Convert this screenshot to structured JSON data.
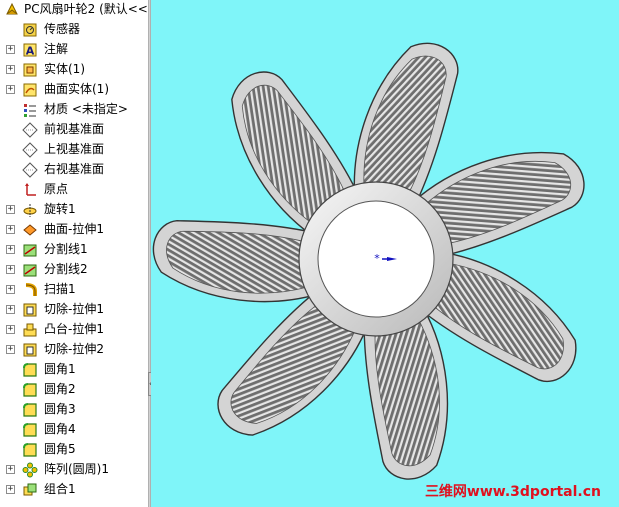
{
  "tree": {
    "root": {
      "label": "PC风扇叶轮2 (默认<<",
      "icon": "part-icon"
    },
    "items": [
      {
        "label": "传感器",
        "icon": "sensor-icon",
        "expandable": false
      },
      {
        "label": "注解",
        "icon": "annotation-icon",
        "expandable": true
      },
      {
        "label": "实体(1)",
        "icon": "solid-bodies-icon",
        "expandable": true
      },
      {
        "label": "曲面实体(1)",
        "icon": "surface-bodies-icon",
        "expandable": true
      },
      {
        "label": "材质 <未指定>",
        "icon": "material-icon",
        "expandable": false
      },
      {
        "label": "前视基准面",
        "icon": "plane-icon",
        "expandable": false
      },
      {
        "label": "上视基准面",
        "icon": "plane-icon",
        "expandable": false
      },
      {
        "label": "右视基准面",
        "icon": "plane-icon",
        "expandable": false
      },
      {
        "label": "原点",
        "icon": "origin-icon",
        "expandable": false
      },
      {
        "label": "旋转1",
        "icon": "revolve-icon",
        "expandable": true
      },
      {
        "label": "曲面-拉伸1",
        "icon": "surface-extrude-icon",
        "expandable": true
      },
      {
        "label": "分割线1",
        "icon": "split-line-icon",
        "expandable": true
      },
      {
        "label": "分割线2",
        "icon": "split-line-icon",
        "expandable": true
      },
      {
        "label": "扫描1",
        "icon": "sweep-icon",
        "expandable": true
      },
      {
        "label": "切除-拉伸1",
        "icon": "cut-extrude-icon",
        "expandable": true
      },
      {
        "label": "凸台-拉伸1",
        "icon": "boss-extrude-icon",
        "expandable": true
      },
      {
        "label": "切除-拉伸2",
        "icon": "cut-extrude-icon",
        "expandable": true
      },
      {
        "label": "圆角1",
        "icon": "fillet-icon",
        "expandable": false
      },
      {
        "label": "圆角2",
        "icon": "fillet-icon",
        "expandable": false
      },
      {
        "label": "圆角3",
        "icon": "fillet-icon",
        "expandable": false
      },
      {
        "label": "圆角4",
        "icon": "fillet-icon",
        "expandable": false
      },
      {
        "label": "圆角5",
        "icon": "fillet-icon",
        "expandable": false
      },
      {
        "label": "阵列(圆周)1",
        "icon": "circular-pattern-icon",
        "expandable": true
      },
      {
        "label": "组合1",
        "icon": "combine-icon",
        "expandable": true
      }
    ]
  },
  "viewport": {
    "background": "#7ff5f9",
    "watermark": "三维网www.3dportal.cn",
    "blade_count": 7
  }
}
